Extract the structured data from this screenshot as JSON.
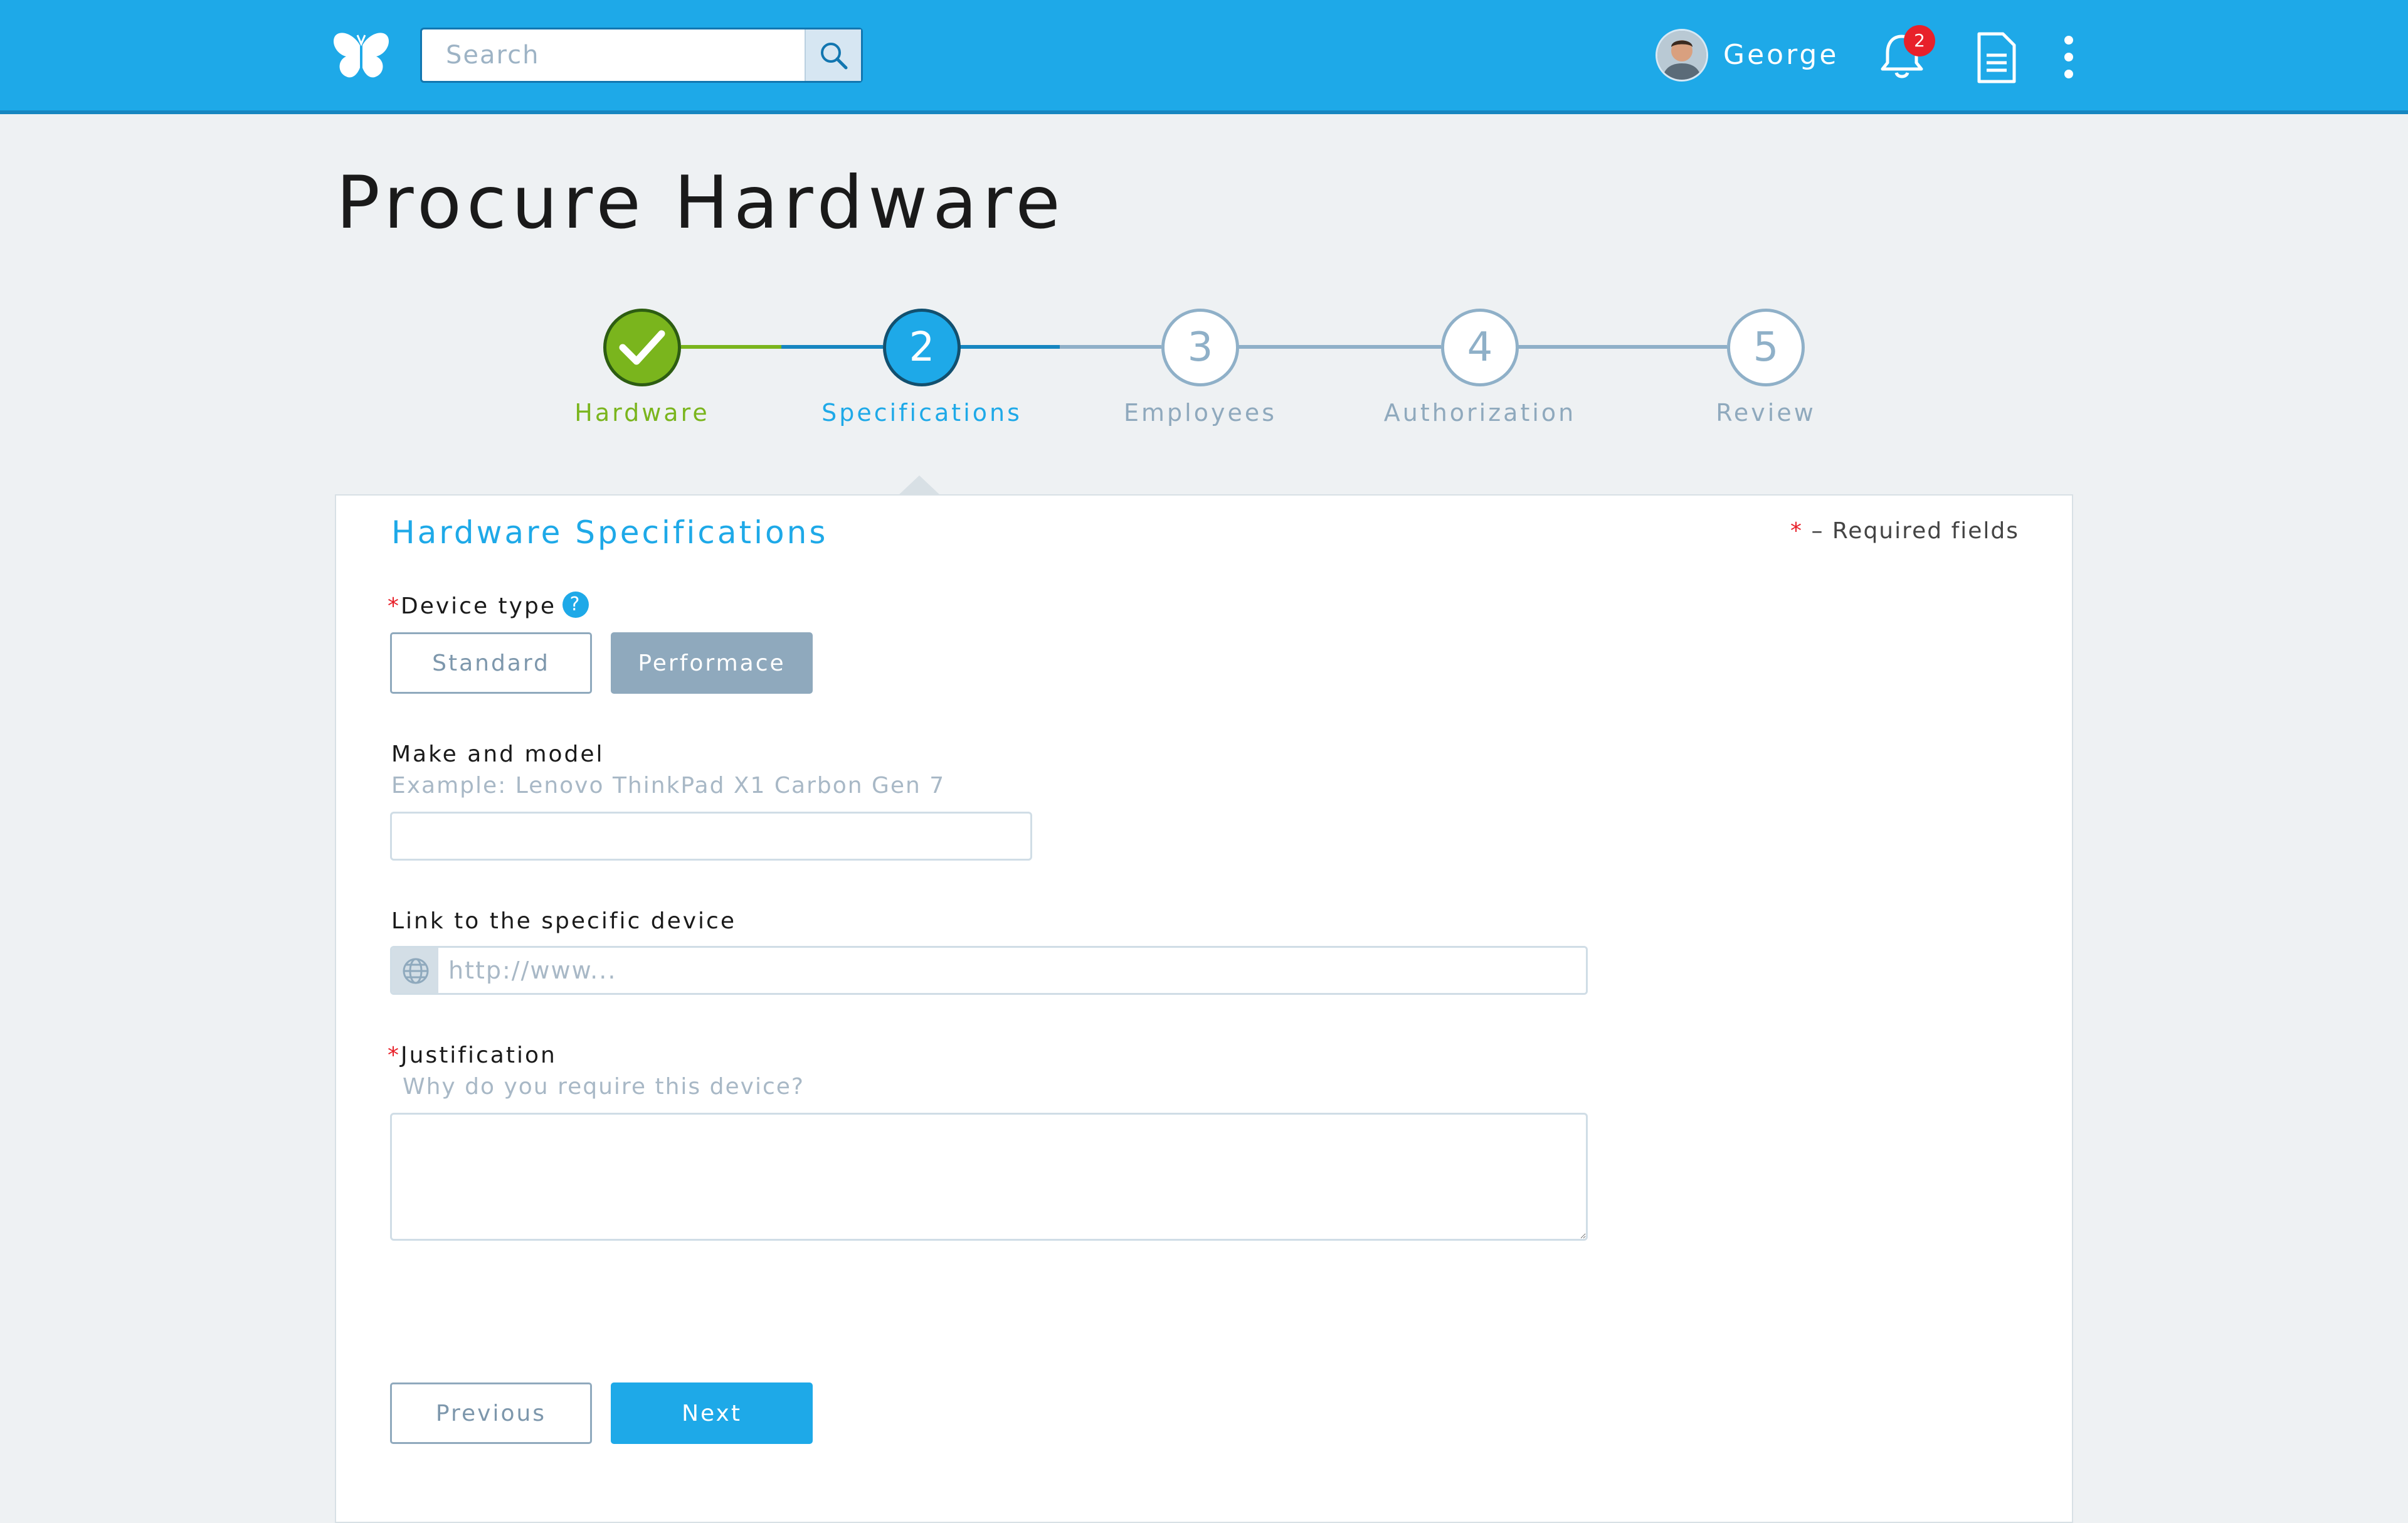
{
  "header": {
    "search_placeholder": "Search",
    "user_name": "George",
    "notifications_count": "2",
    "colors": {
      "bar": "#1ea9e8",
      "badge": "#e8212a"
    }
  },
  "page": {
    "title": "Procure Hardware"
  },
  "stepper": {
    "current_step": 2,
    "steps": [
      {
        "number": "1",
        "label": "Hardware",
        "state": "done"
      },
      {
        "number": "2",
        "label": "Specifications",
        "state": "active"
      },
      {
        "number": "3",
        "label": "Employees",
        "state": "pending"
      },
      {
        "number": "4",
        "label": "Authorization",
        "state": "pending"
      },
      {
        "number": "5",
        "label": "Review",
        "state": "pending"
      }
    ],
    "colors": {
      "done": "#7ab51d",
      "active": "#1ea9e8",
      "pending": "#8fb0c8"
    }
  },
  "form": {
    "section_title": "Hardware Specifications",
    "required_star": "*",
    "required_note": "– Required fields",
    "device_type": {
      "label": "Device type",
      "help": "?",
      "options": [
        "Standard",
        "Performace"
      ],
      "selected": "Performace"
    },
    "make_model": {
      "label": "Make and model",
      "hint": "Example: Lenovo ThinkPad X1 Carbon Gen 7",
      "value": ""
    },
    "link": {
      "label": "Link to the specific device",
      "placeholder": "http://www...",
      "value": ""
    },
    "justification": {
      "label": "Justification",
      "hint": "Why do you require this device?",
      "value": ""
    },
    "buttons": {
      "previous": "Previous",
      "next": "Next"
    }
  }
}
